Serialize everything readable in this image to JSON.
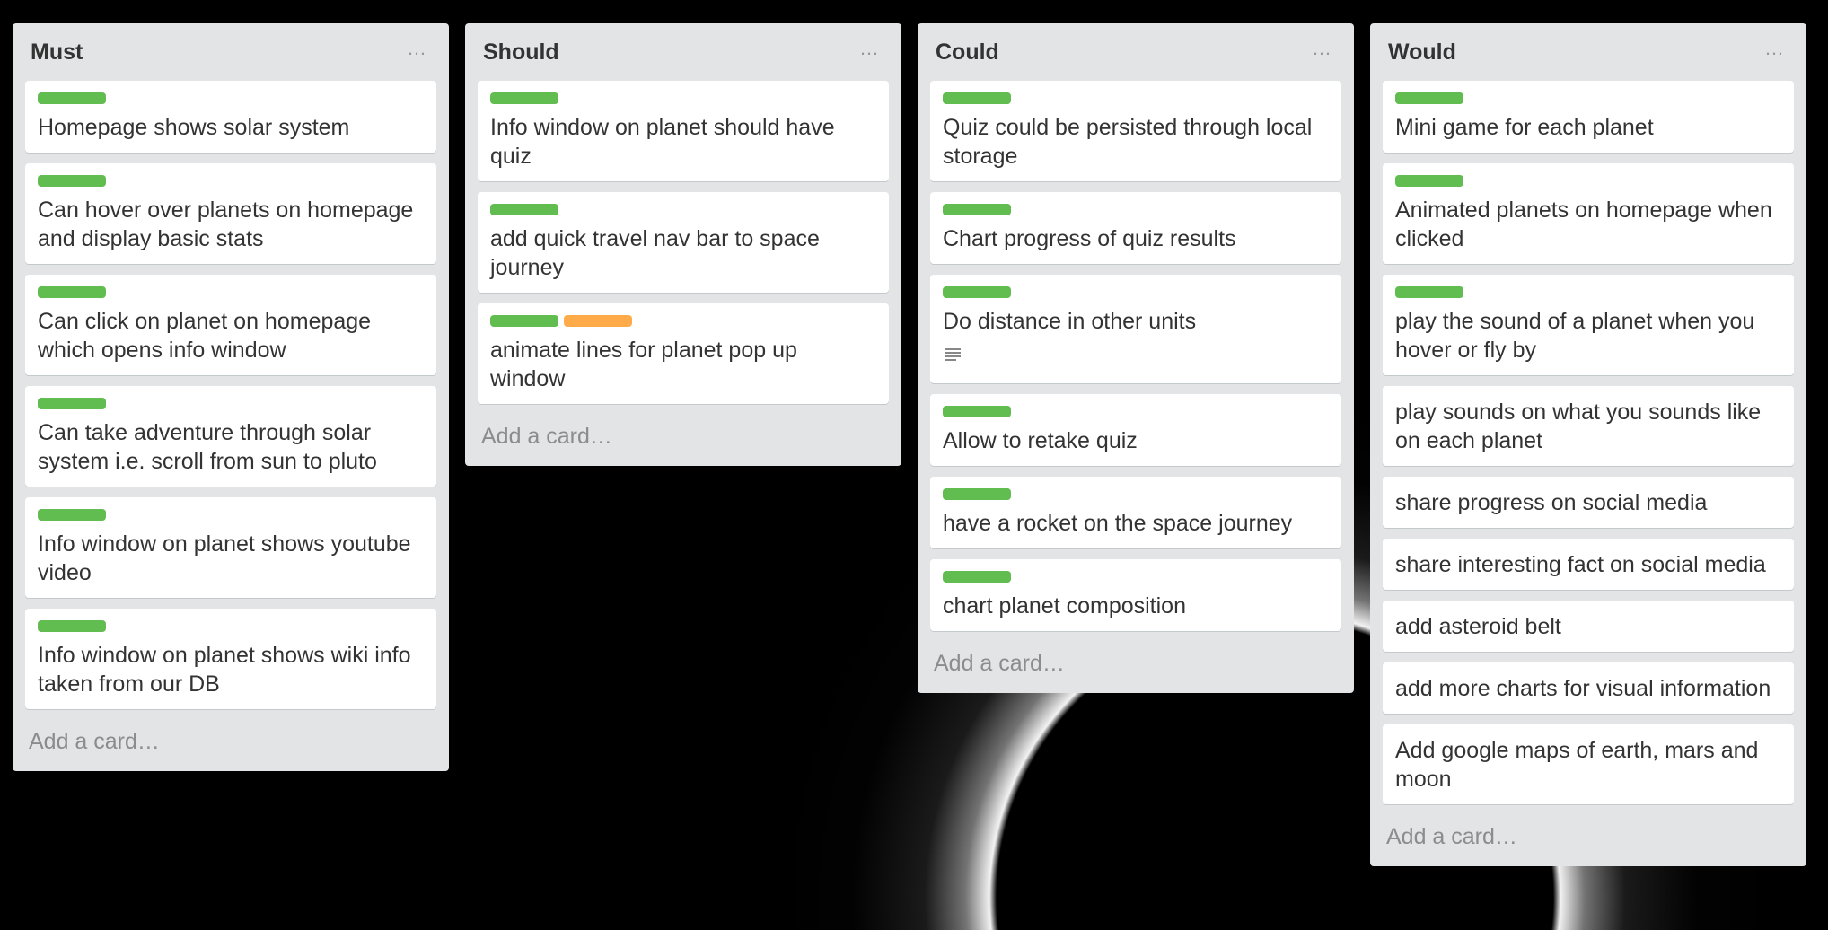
{
  "colors": {
    "label_green": "#61bd4f",
    "label_orange": "#ffab4a"
  },
  "lists": [
    {
      "title": "Must",
      "menu_icon": "…",
      "add_card": "Add a card…",
      "cards": [
        {
          "labels": [
            "green"
          ],
          "text": "Homepage shows solar system"
        },
        {
          "labels": [
            "green"
          ],
          "text": "Can hover over planets on homepage and display basic stats"
        },
        {
          "labels": [
            "green"
          ],
          "text": "Can click on planet on homepage which opens info window"
        },
        {
          "labels": [
            "green"
          ],
          "text": "Can take adventure through solar system i.e. scroll from sun to pluto"
        },
        {
          "labels": [
            "green"
          ],
          "text": "Info window on planet shows youtube video"
        },
        {
          "labels": [
            "green"
          ],
          "text": "Info window on planet shows wiki info taken from our DB"
        }
      ]
    },
    {
      "title": "Should",
      "menu_icon": "…",
      "add_card": "Add a card…",
      "cards": [
        {
          "labels": [
            "green"
          ],
          "text": "Info window on planet should have quiz"
        },
        {
          "labels": [
            "green"
          ],
          "text": "add quick travel nav bar to space journey"
        },
        {
          "labels": [
            "green",
            "orange"
          ],
          "text": "animate lines for planet pop up window"
        }
      ]
    },
    {
      "title": "Could",
      "menu_icon": "…",
      "add_card": "Add a card…",
      "cards": [
        {
          "labels": [
            "green"
          ],
          "text": "Quiz could be persisted through local storage"
        },
        {
          "labels": [
            "green"
          ],
          "text": "Chart progress of quiz results"
        },
        {
          "labels": [
            "green"
          ],
          "text": "Do distance in other units",
          "description_icon": "description-icon"
        },
        {
          "labels": [
            "green"
          ],
          "text": "Allow to retake quiz"
        },
        {
          "labels": [
            "green"
          ],
          "text": "have a rocket on the space journey"
        },
        {
          "labels": [
            "green"
          ],
          "text": "chart planet composition"
        }
      ]
    },
    {
      "title": "Would",
      "menu_icon": "…",
      "add_card": "Add a card…",
      "cards": [
        {
          "labels": [
            "green"
          ],
          "text": "Mini game for each planet"
        },
        {
          "labels": [
            "green"
          ],
          "text": "Animated planets on homepage when clicked"
        },
        {
          "labels": [
            "green"
          ],
          "text": "play the sound of a planet when you hover or fly by"
        },
        {
          "labels": [],
          "text": "play sounds on what you sounds like on each planet"
        },
        {
          "labels": [],
          "text": "share progress on social media"
        },
        {
          "labels": [],
          "text": "share interesting fact on social media"
        },
        {
          "labels": [],
          "text": "add asteroid belt"
        },
        {
          "labels": [],
          "text": "add more charts for visual information"
        },
        {
          "labels": [],
          "text": "Add google maps of earth, mars and moon"
        }
      ]
    }
  ]
}
